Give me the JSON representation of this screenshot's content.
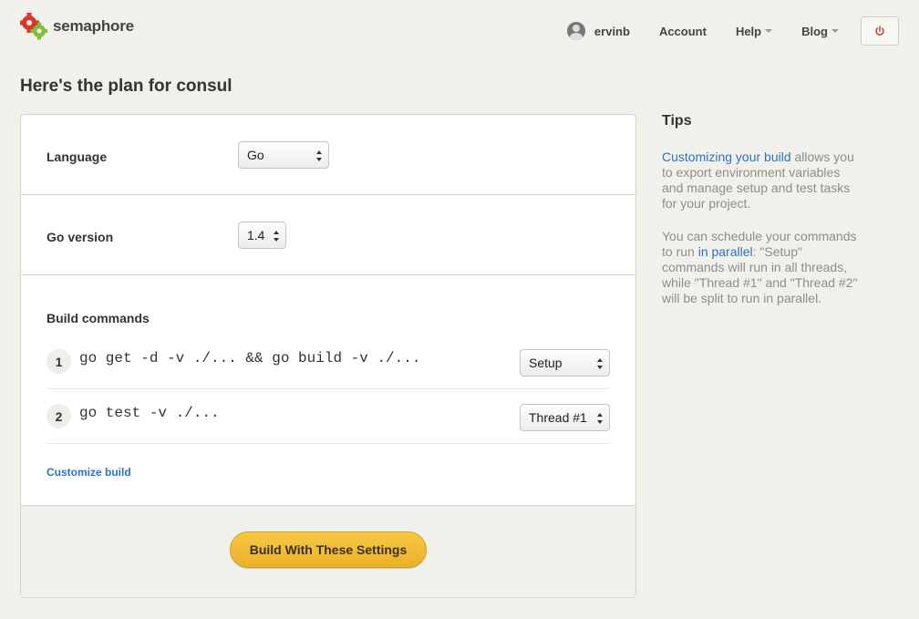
{
  "brand": {
    "name": "semaphore"
  },
  "nav": {
    "username": "ervinb",
    "account": "Account",
    "help": "Help",
    "blog": "Blog"
  },
  "page": {
    "title": "Here's the plan for consul"
  },
  "language": {
    "label": "Language",
    "value": "Go"
  },
  "go_version": {
    "label": "Go version",
    "value": "1.4"
  },
  "build": {
    "label": "Build commands",
    "commands": [
      {
        "num": "1",
        "text": "go get -d -v ./... && go build -v ./...",
        "thread": "Setup"
      },
      {
        "num": "2",
        "text": "go test -v ./...",
        "thread": "Thread #1"
      }
    ],
    "customize_link": "Customize build",
    "submit_label": "Build With These Settings"
  },
  "tips": {
    "title": "Tips",
    "p1_link": "Customizing your build",
    "p1_rest": " allows you to export environment variables and manage setup and test tasks for your project.",
    "p2_start": "You can schedule your commands to run ",
    "p2_link": "in parallel",
    "p2_rest": ": \"Setup\" commands will run in all threads, while \"Thread #1\" and \"Thread #2\" will be split to run in parallel."
  },
  "colors": {
    "accent_link": "#2a75c1",
    "button_yellow": "#f7c843",
    "logo_red": "#d9372c",
    "logo_green": "#7cbf42",
    "power_red": "#c8352c"
  }
}
